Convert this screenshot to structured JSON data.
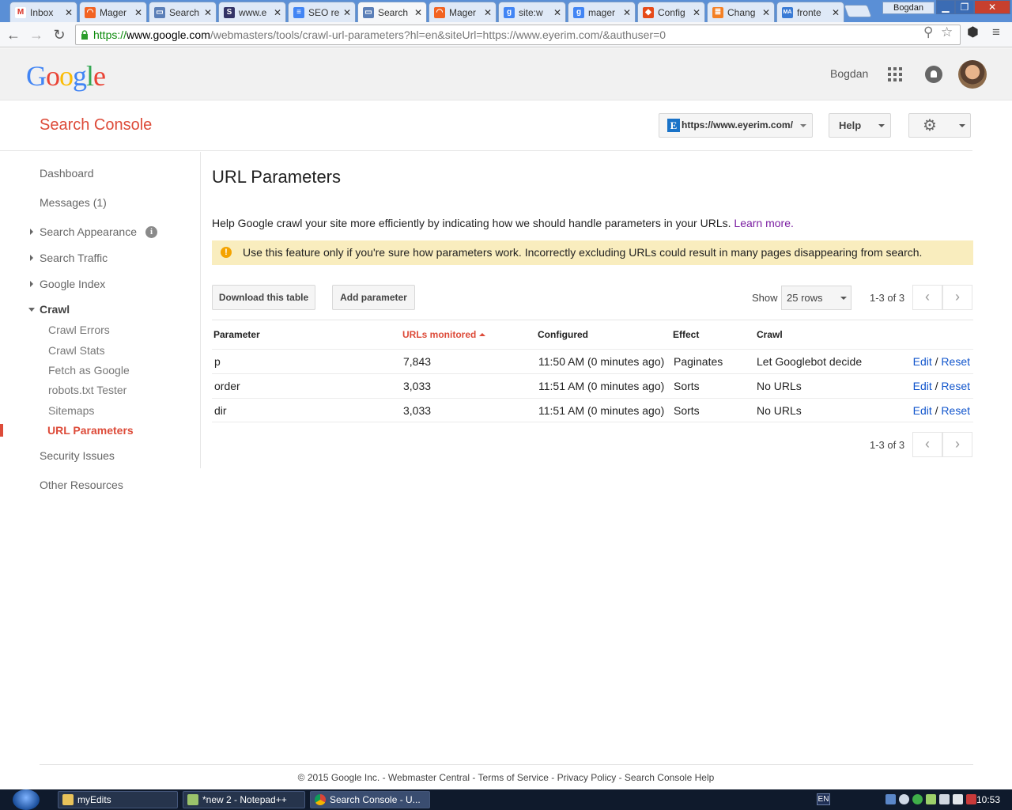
{
  "browser": {
    "tabs": [
      {
        "title": "Inbox",
        "icon": "gmail-icon",
        "color": "#d93025"
      },
      {
        "title": "Mager",
        "icon": "magento-icon",
        "color": "#f26322"
      },
      {
        "title": "Search",
        "icon": "search-console-icon",
        "color": "#5b7fb8"
      },
      {
        "title": "www.e",
        "icon": "s-icon",
        "color": "#333366"
      },
      {
        "title": "SEO re",
        "icon": "docs-icon",
        "color": "#4285f4"
      },
      {
        "title": "Search",
        "icon": "search-console-icon",
        "color": "#5b7fb8",
        "active": true
      },
      {
        "title": "Mager",
        "icon": "magento-icon",
        "color": "#f26322"
      },
      {
        "title": "site:w",
        "icon": "google-icon",
        "color": "#4285f4"
      },
      {
        "title": "mager",
        "icon": "google-icon",
        "color": "#4285f4"
      },
      {
        "title": "Config",
        "icon": "magento-logo-icon",
        "color": "#e64a19"
      },
      {
        "title": "Chang",
        "icon": "stack-icon",
        "color": "#f48024"
      },
      {
        "title": "fronte",
        "icon": "ma-icon",
        "color": "#3a7bd5"
      }
    ],
    "profile_name": "Bogdan",
    "url": {
      "scheme": "https://",
      "host": "www.google.com",
      "path": "/webmasters/tools/crawl-url-parameters?hl=en&siteUrl=https://www.eyerim.com/&authuser=0"
    }
  },
  "google_header": {
    "logo_text": "Google",
    "user_name": "Bogdan"
  },
  "console": {
    "title": "Search Console",
    "site_icon_letter": "E",
    "site": "https://www.eyerim.com/",
    "help_label": "Help"
  },
  "sidebar": {
    "dashboard": "Dashboard",
    "messages": "Messages (1)",
    "search_appearance": "Search Appearance",
    "search_traffic": "Search Traffic",
    "google_index": "Google Index",
    "crawl": "Crawl",
    "crawl_items": [
      "Crawl Errors",
      "Crawl Stats",
      "Fetch as Google",
      "robots.txt Tester",
      "Sitemaps",
      "URL Parameters"
    ],
    "security_issues": "Security Issues",
    "other_resources": "Other Resources"
  },
  "main": {
    "title": "URL Parameters",
    "intro": "Help Google crawl your site more efficiently by indicating how we should handle parameters in your URLs.",
    "learn_more": "Learn more.",
    "warning": "Use this feature only if you're sure how parameters work. Incorrectly excluding URLs could result in many pages disappearing from search.",
    "download_label": "Download this table",
    "add_label": "Add parameter",
    "show_label": "Show",
    "rows_option": "25 rows",
    "pager_text": "1-3 of 3"
  },
  "table": {
    "headers": [
      "Parameter",
      "URLs monitored",
      "Configured",
      "Effect",
      "Crawl"
    ],
    "rows": [
      {
        "parameter": "p",
        "urls": "7,843",
        "configured": "11:50 AM (0 minutes ago)",
        "effect": "Paginates",
        "crawl": "Let Googlebot decide"
      },
      {
        "parameter": "order",
        "urls": "3,033",
        "configured": "11:51 AM (0 minutes ago)",
        "effect": "Sorts",
        "crawl": "No URLs"
      },
      {
        "parameter": "dir",
        "urls": "3,033",
        "configured": "11:51 AM (0 minutes ago)",
        "effect": "Sorts",
        "crawl": "No URLs"
      }
    ],
    "edit_label": "Edit",
    "separator": "/",
    "reset_label": "Reset"
  },
  "footer": {
    "copyright": "© 2015 Google Inc.",
    "links": [
      "Webmaster Central",
      "Terms of Service",
      "Privacy Policy",
      "Search Console Help"
    ]
  },
  "taskbar": {
    "items": [
      "myEdits",
      "*new  2 - Notepad++",
      "Search Console - U..."
    ],
    "lang": "EN",
    "clock": "10:53"
  },
  "colors": {
    "accent_red": "#dd4b39",
    "link_blue": "#1155cc",
    "warning_bg": "#f9edbe"
  }
}
